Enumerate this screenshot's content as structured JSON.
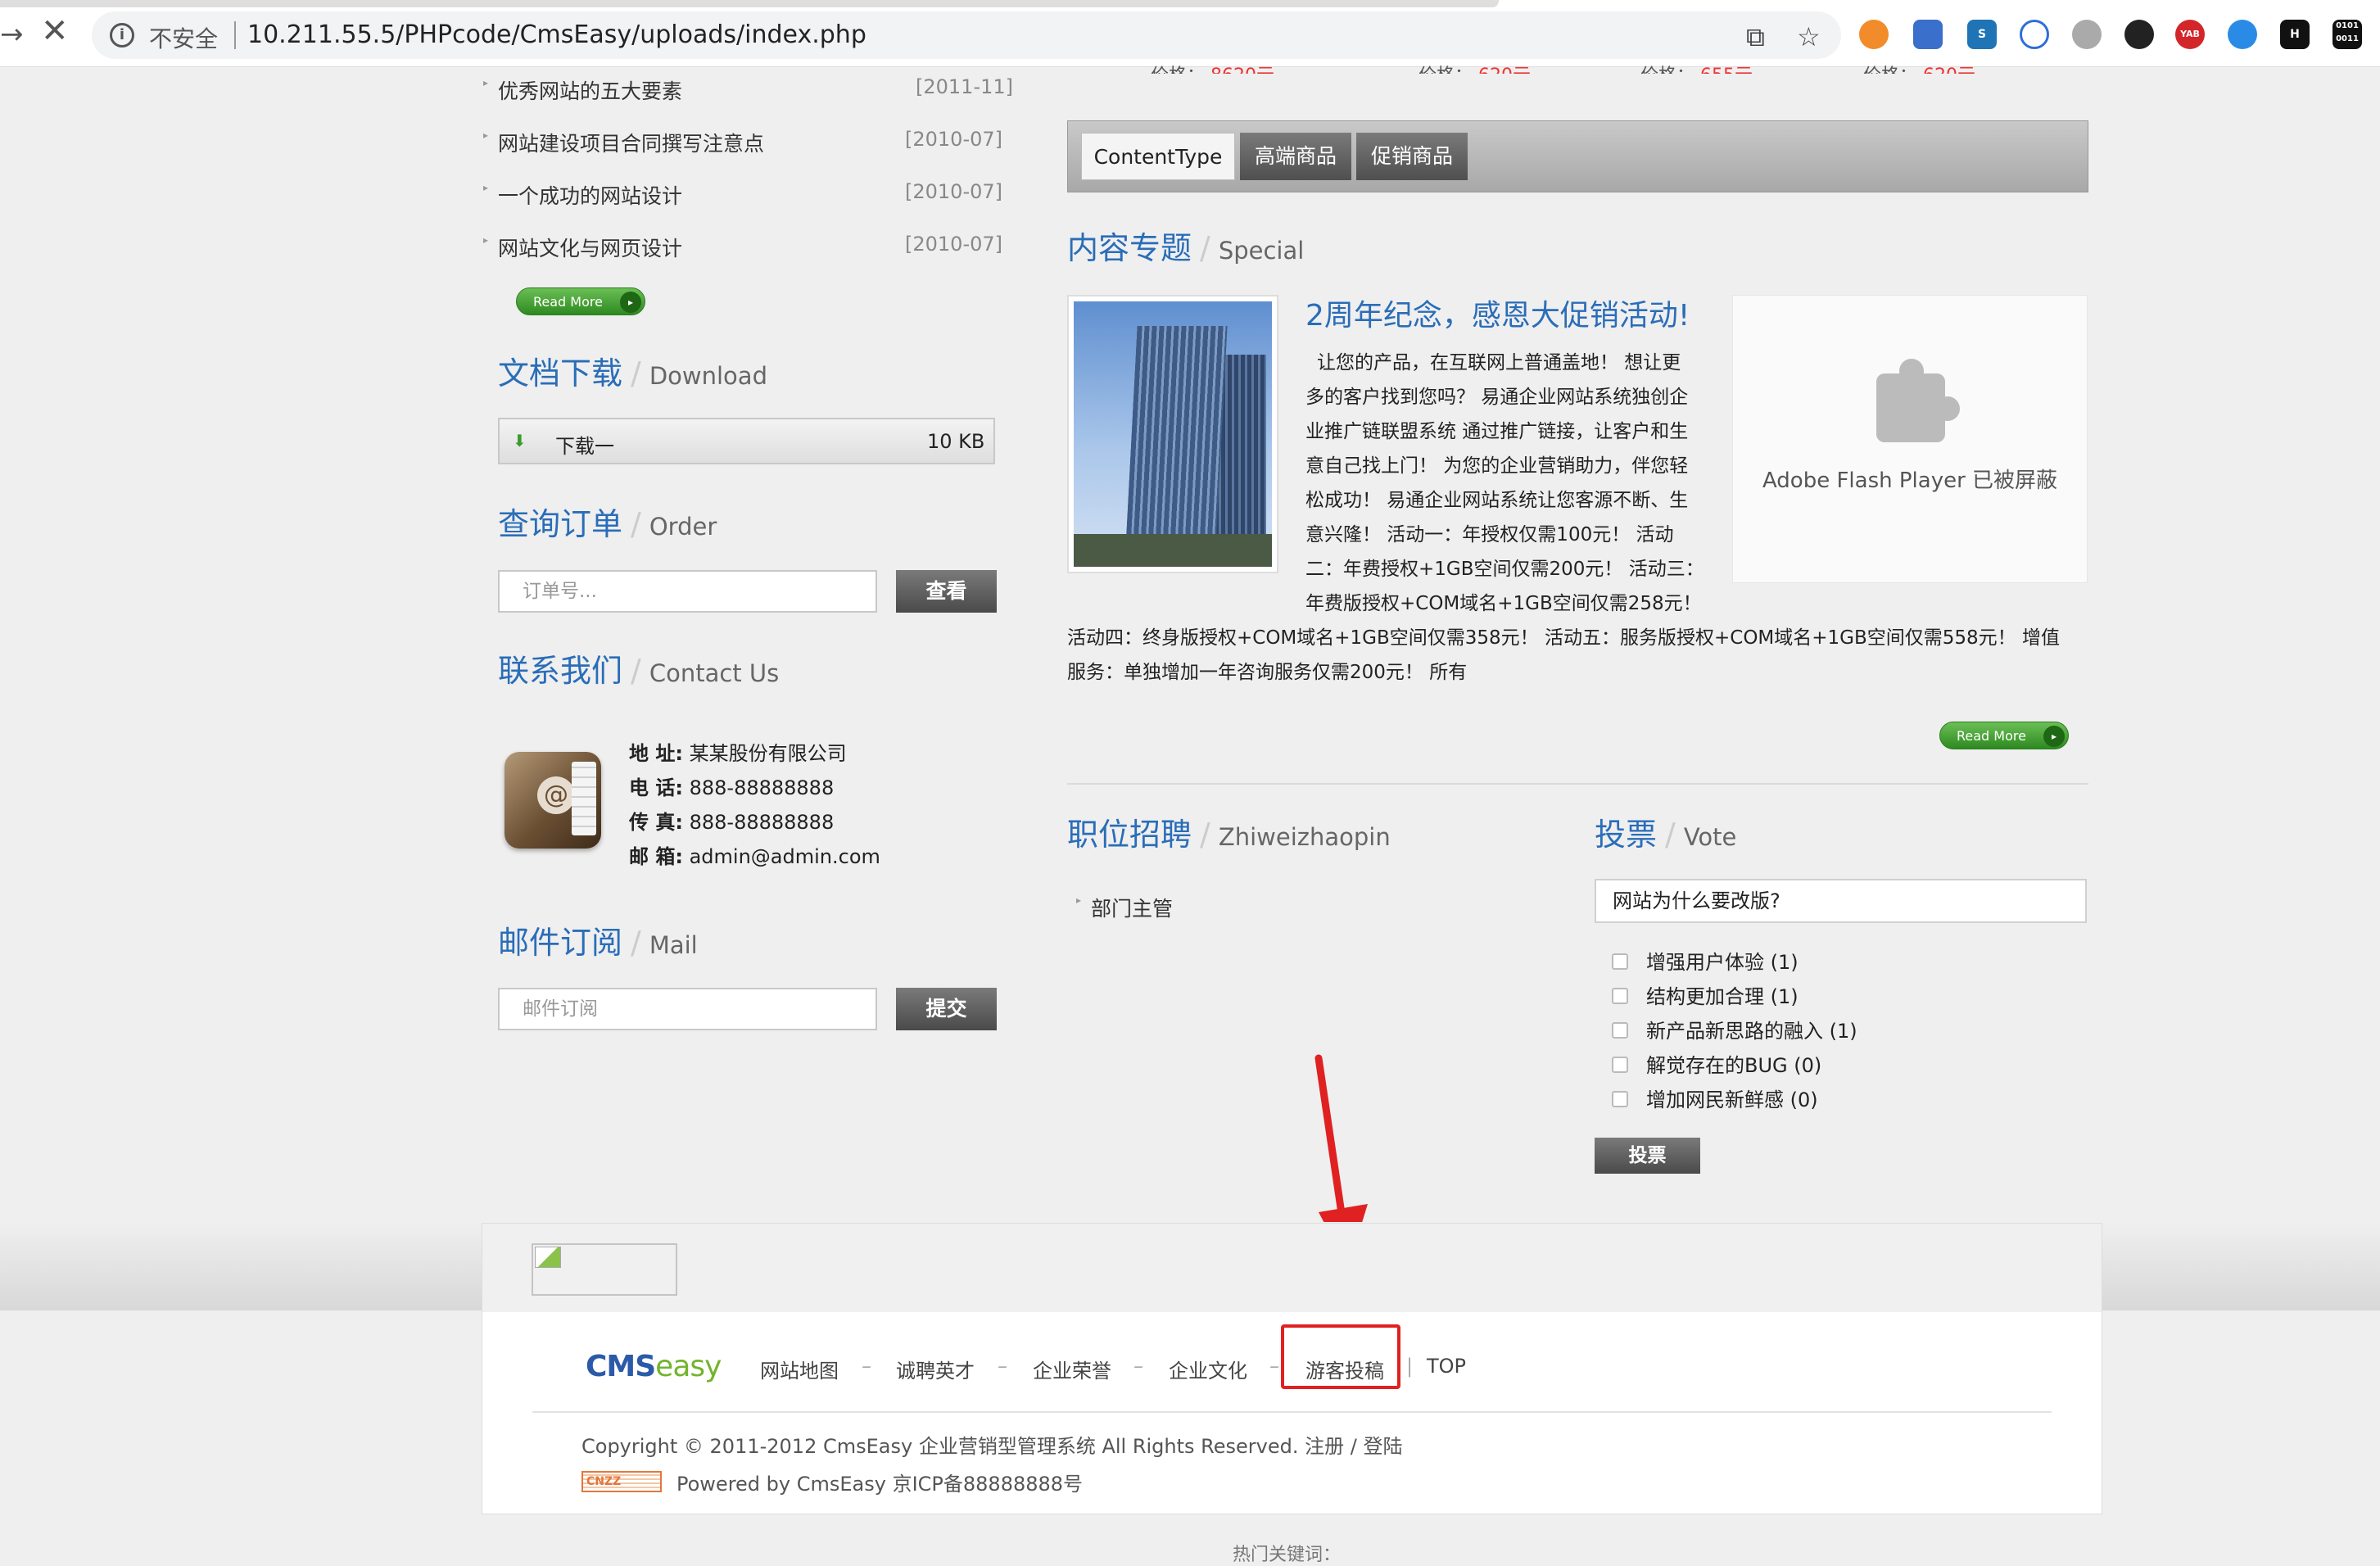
{
  "browser": {
    "security_label": "不安全",
    "url": "10.211.55.5/PHPcode/CmsEasy/uploads/index.php"
  },
  "top_price_fragments": [
    "价格：",
    "价格：",
    "价格：",
    "价格："
  ],
  "articles": [
    {
      "title": "优秀网站的五大要素",
      "date": "[2011-11]"
    },
    {
      "title": "网站建设项目合同撰写注意点",
      "date": "[2010-07]"
    },
    {
      "title": "一个成功的网站设计",
      "date": "[2010-07]"
    },
    {
      "title": "网站文化与网页设计",
      "date": "[2010-07]"
    }
  ],
  "read_more": "Read More",
  "download": {
    "title": "文档下载",
    "en": "Download",
    "item_name": "下载一",
    "item_size": "10 KB"
  },
  "order": {
    "title": "查询订单",
    "en": "Order",
    "placeholder": "订单号...",
    "button": "查看"
  },
  "contact": {
    "title": "联系我们",
    "en": "Contact Us",
    "address_label": "地 址:",
    "address": "某某股份有限公司",
    "phone_label": "电 话:",
    "phone": "888-88888888",
    "fax_label": "传 真:",
    "fax": "888-88888888",
    "email_label": "邮 箱:",
    "email": "admin@admin.com"
  },
  "mail": {
    "title": "邮件订阅",
    "en": "Mail",
    "placeholder": "邮件订阅",
    "button": "提交"
  },
  "content_tabs": [
    "ContentType",
    "高端商品",
    "促销商品"
  ],
  "special": {
    "title": "内容专题",
    "en": "Special",
    "headline": "2周年纪念，感恩大促销活动!",
    "lines": [
      "让您的产品，在互联网上普通盖地！ 想让更",
      "多的客户找到您吗？ 易通企业网站系统独创企",
      "业推广链联盟系统 通过推广链接，让客户和生",
      "意自己找上门！ 为您的企业营销助力，伴您轻",
      "松成功！ 易通企业网站系统让您客源不断、生",
      "意兴隆！   活动一：年授权仅需100元！ 活动",
      "二：年费授权+1GB空间仅需200元！ 活动三：",
      "年费版授权+COM域名+1GB空间仅需258元！"
    ],
    "wide_lines": [
      "活动四：终身版授权+COM域名+1GB空间仅需358元！ 活动五：服务版授权+COM域名+1GB空间仅需558元！ 增值",
      "服务：单独增加一年咨询服务仅需200元！ 所有"
    ]
  },
  "flash_blocked": "Adobe Flash Player 已被屏蔽",
  "jobs": {
    "title": "职位招聘",
    "en": "Zhiweizhaopin",
    "items": [
      "部门主管"
    ]
  },
  "vote": {
    "title": "投票",
    "en": "Vote",
    "question": "网站为什么要改版?",
    "options": [
      "增强用户体验 (1)",
      "结构更加合理 (1)",
      "新产品新思路的融入 (1)",
      "解觉存在的BUG (0)",
      "增加网民新鲜感 (0)"
    ],
    "button": "投票"
  },
  "footer": {
    "logo_text_1": "CMS",
    "logo_text_2": "easy",
    "links": [
      "网站地图",
      "诚聘英才",
      "企业荣誉",
      "企业文化",
      "游客投稿",
      "TOP"
    ],
    "copyright": "Copyright © 2011-2012 CmsEasy 企业营销型管理系统 All Rights Reserved.   注册 / 登陆",
    "cnzz": "CNZZ",
    "powered": "Powered by CmsEasy  京ICP备88888888号",
    "hot_keywords": "热门关键词："
  },
  "colors": {
    "accent_blue": "#2a6db8",
    "highlight_red": "#e02121",
    "readmore_green": "#3e9c2c"
  }
}
